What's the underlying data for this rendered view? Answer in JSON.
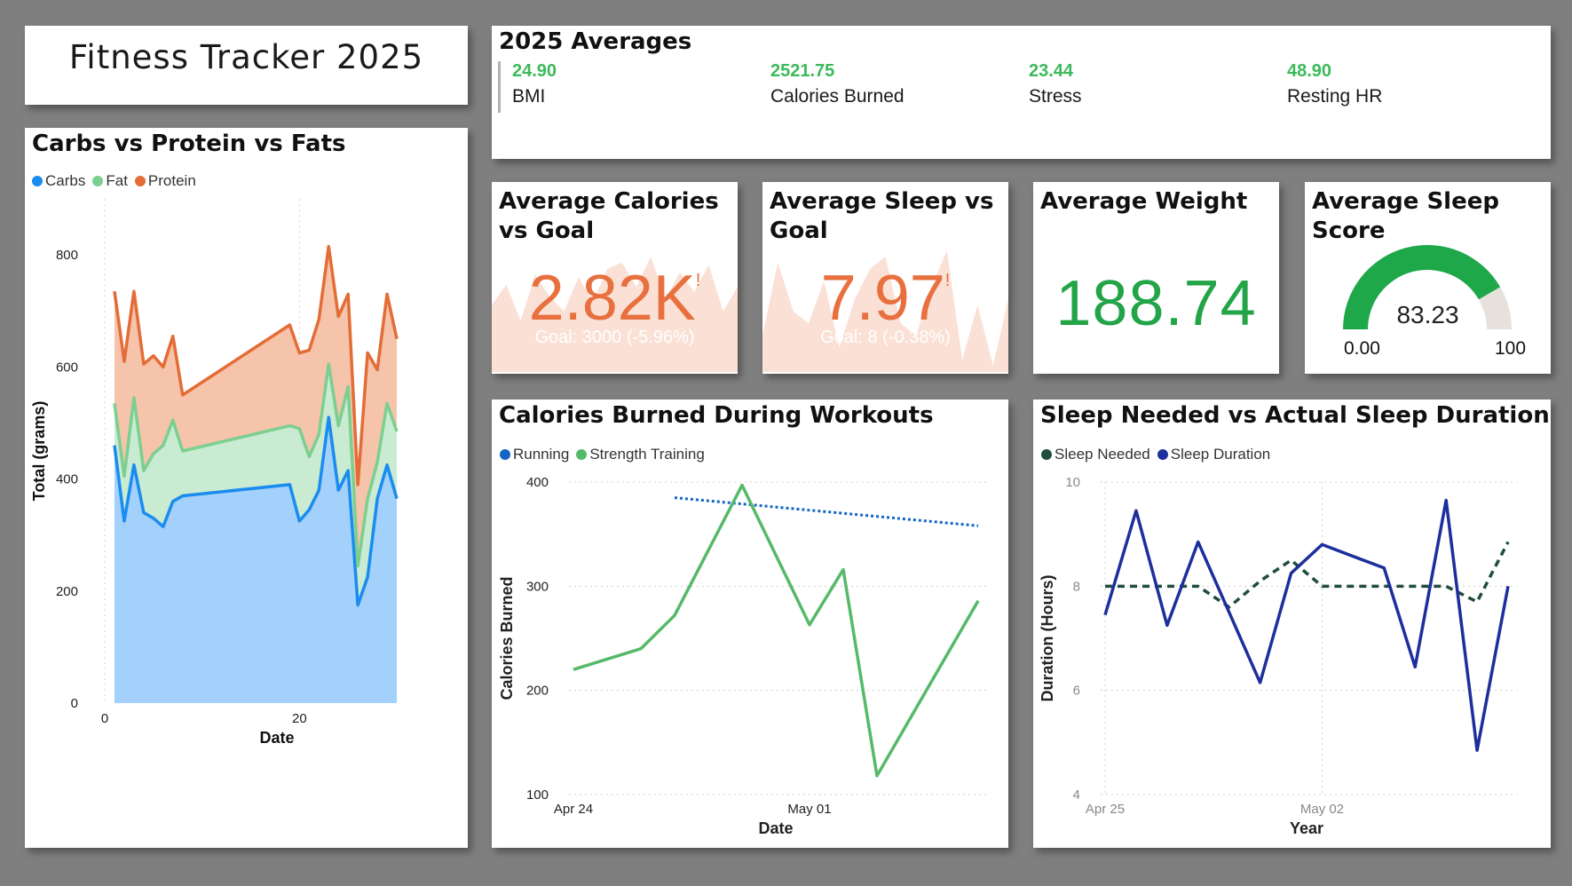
{
  "header": {
    "title": "Fitness Tracker 2025"
  },
  "averages": {
    "title": "2025 Averages",
    "items": [
      {
        "value": "24.90",
        "label": "BMI"
      },
      {
        "value": "2521.75",
        "label": "Calories Burned"
      },
      {
        "value": "23.44",
        "label": "Stress"
      },
      {
        "value": "48.90",
        "label": "Resting HR"
      }
    ]
  },
  "kpis": {
    "calories": {
      "title": "Average Calories\nvs Goal",
      "value": "2.82K",
      "flag": "!",
      "goal_text": "Goal: 3000 (-5.96%)",
      "color": "#e8703e",
      "trend": [
        0.55,
        0.72,
        0.42,
        0.8,
        0.62,
        0.5,
        0.78,
        0.58,
        0.85,
        0.9,
        0.7,
        0.95,
        0.6,
        0.82,
        0.66,
        0.88,
        0.5,
        0.7
      ]
    },
    "sleep": {
      "title": "Average Sleep vs\nGoal",
      "value": "7.97",
      "flag": "!",
      "goal_text": "Goal: 8 (-0.38%)",
      "color": "#e8703e",
      "trend": [
        0.3,
        0.9,
        0.5,
        0.4,
        0.75,
        0.2,
        0.6,
        0.85,
        0.95,
        0.4,
        0.3,
        0.7,
        1.0,
        0.1,
        0.55,
        0.05,
        0.6
      ]
    },
    "weight": {
      "title": "Average Weight",
      "value": "188.74",
      "color": "#22a447"
    },
    "sleep_score": {
      "title": "Average Sleep\nScore",
      "value": "83.23",
      "min_label": "0.00",
      "max_label": "100",
      "fill_fraction": 0.8323,
      "fill_color": "#1ea84a",
      "track_color": "#e6e1dc"
    }
  },
  "chart_data": [
    {
      "id": "macros",
      "type": "area",
      "stacked": true,
      "title": "Carbs vs Protein vs Fats",
      "xlabel": "Date",
      "ylabel": "Total (grams)",
      "xlim": [
        0,
        31
      ],
      "ylim": [
        0,
        900
      ],
      "x_ticks": [
        0,
        20
      ],
      "y_ticks": [
        0,
        200,
        400,
        600,
        800
      ],
      "legend_position": "top-left",
      "x": [
        1,
        2,
        3,
        4,
        5,
        6,
        7,
        8,
        19,
        20,
        21,
        22,
        23,
        24,
        25,
        26,
        27,
        28,
        29,
        30
      ],
      "series": [
        {
          "name": "Carbs",
          "color": "#1a8cf0",
          "fill": "#a3d1fb",
          "values": [
            460,
            325,
            425,
            340,
            330,
            315,
            360,
            370,
            390,
            325,
            345,
            380,
            510,
            380,
            415,
            175,
            225,
            365,
            425,
            365
          ]
        },
        {
          "name": "Fat",
          "color": "#7ccf90",
          "fill": "#c8ebd2",
          "values": [
            75,
            80,
            120,
            75,
            115,
            145,
            145,
            80,
            105,
            165,
            95,
            100,
            95,
            115,
            150,
            70,
            140,
            65,
            110,
            120
          ]
        },
        {
          "name": "Protein",
          "color": "#e46c37",
          "fill": "#f5c4aa",
          "values": [
            200,
            205,
            190,
            190,
            175,
            140,
            150,
            100,
            180,
            135,
            190,
            205,
            210,
            195,
            165,
            145,
            260,
            165,
            195,
            165
          ]
        }
      ]
    },
    {
      "id": "workouts",
      "type": "line",
      "title": "Calories Burned During Workouts",
      "xlabel": "Date",
      "ylabel": "Calories Burned",
      "ylim": [
        100,
        400
      ],
      "y_ticks": [
        100,
        200,
        300,
        400
      ],
      "x_tick_labels": [
        {
          "x": "2025-04-24",
          "label": "Apr 24"
        },
        {
          "x": "2025-05-01",
          "label": "May 01"
        }
      ],
      "legend_position": "top-left",
      "series": [
        {
          "name": "Running",
          "color": "#1466c1",
          "style": "dotted",
          "points": [
            [
              "2025-04-27",
              385
            ],
            [
              "2025-05-06",
              358
            ]
          ]
        },
        {
          "name": "Strength Training",
          "color": "#55b96a",
          "style": "solid",
          "points": [
            [
              "2025-04-24",
              220
            ],
            [
              "2025-04-26",
              240
            ],
            [
              "2025-04-27",
              272
            ],
            [
              "2025-04-29",
              397
            ],
            [
              "2025-05-01",
              263
            ],
            [
              "2025-05-02",
              316
            ],
            [
              "2025-05-03",
              118
            ],
            [
              "2025-05-06",
              286
            ]
          ]
        }
      ]
    },
    {
      "id": "sleep",
      "type": "line",
      "title": "Sleep Needed vs Actual Sleep Duration",
      "xlabel": "Year",
      "ylabel": "Duration (Hours)",
      "ylim": [
        4,
        10
      ],
      "y_ticks": [
        4,
        6,
        8,
        10
      ],
      "x_tick_labels": [
        {
          "x": "2025-04-25",
          "label": "Apr 25"
        },
        {
          "x": "2025-05-02",
          "label": "May 02"
        }
      ],
      "legend_position": "top-left",
      "series": [
        {
          "name": "Sleep Needed",
          "color": "#1f4d3f",
          "style": "dashed",
          "points": [
            [
              "2025-04-25",
              8.0
            ],
            [
              "2025-04-26",
              8.0
            ],
            [
              "2025-04-28",
              8.0
            ],
            [
              "2025-04-29",
              7.6
            ],
            [
              "2025-04-30",
              8.1
            ],
            [
              "2025-05-01",
              8.5
            ],
            [
              "2025-05-02",
              8.0
            ],
            [
              "2025-05-04",
              8.0
            ],
            [
              "2025-05-05",
              8.0
            ],
            [
              "2025-05-06",
              8.0
            ],
            [
              "2025-05-07",
              7.7
            ],
            [
              "2025-05-08",
              8.85
            ]
          ]
        },
        {
          "name": "Sleep Duration",
          "color": "#1c2f9c",
          "style": "solid",
          "points": [
            [
              "2025-04-25",
              7.45
            ],
            [
              "2025-04-26",
              9.45
            ],
            [
              "2025-04-27",
              7.25
            ],
            [
              "2025-04-28",
              8.85
            ],
            [
              "2025-04-30",
              6.15
            ],
            [
              "2025-05-01",
              8.25
            ],
            [
              "2025-05-02",
              8.8
            ],
            [
              "2025-05-04",
              8.35
            ],
            [
              "2025-05-05",
              6.45
            ],
            [
              "2025-05-06",
              9.65
            ],
            [
              "2025-05-07",
              4.85
            ],
            [
              "2025-05-08",
              8.0
            ]
          ]
        }
      ]
    }
  ]
}
